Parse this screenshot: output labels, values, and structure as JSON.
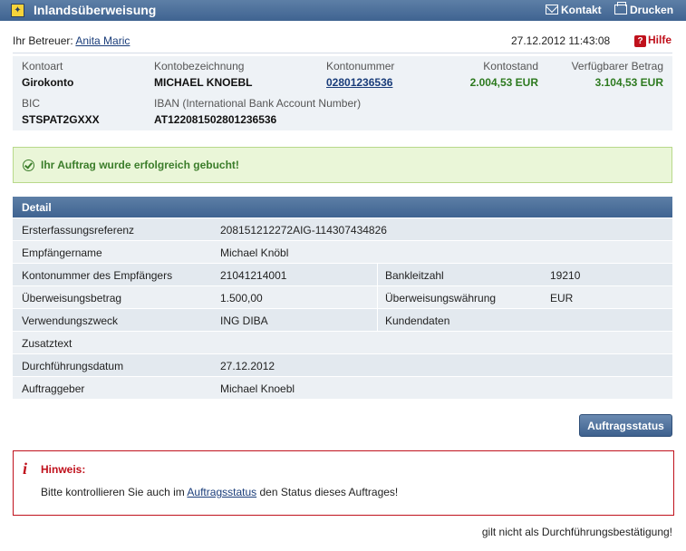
{
  "header": {
    "title": "Inlandsüberweisung",
    "kontakt_label": "Kontakt",
    "drucken_label": "Drucken"
  },
  "info": {
    "betreuer_label": "Ihr Betreuer:",
    "betreuer_name": "Anita Maric",
    "datetime": "27.12.2012 11:43:08",
    "hilfe_label": "Hilfe"
  },
  "account": {
    "kontoart_label": "Kontoart",
    "kontoart": "Girokonto",
    "bezeichnung_label": "Kontobezeichnung",
    "bezeichnung": "MICHAEL KNOEBL",
    "nummer_label": "Kontonummer",
    "nummer": "02801236536",
    "stand_label": "Kontostand",
    "stand": "2.004,53 EUR",
    "verfuegbar_label": "Verfügbarer Betrag",
    "verfuegbar": "3.104,53 EUR",
    "bic_label": "BIC",
    "bic": "STSPAT2GXXX",
    "iban_label": "IBAN (International Bank Account Number)",
    "iban": "AT122081502801236536"
  },
  "success_message": "Ihr Auftrag wurde erfolgreich gebucht!",
  "detail": {
    "title": "Detail",
    "rows": [
      {
        "label": "Ersterfassungsreferenz",
        "value": "208151212272AIG-114307434826"
      },
      {
        "label": "Empfängername",
        "value": "Michael Knöbl"
      },
      {
        "label": "Kontonummer des Empfängers",
        "value": "21041214001",
        "label2": "Bankleitzahl",
        "value2": "19210"
      },
      {
        "label": "Überweisungsbetrag",
        "value": "1.500,00",
        "label2": "Überweisungswährung",
        "value2": "EUR"
      },
      {
        "label": "Verwendungszweck",
        "value": "ING DIBA",
        "label2": "Kundendaten",
        "value2": ""
      },
      {
        "label": "Zusatztext",
        "value": ""
      },
      {
        "label": "Durchführungsdatum",
        "value": "27.12.2012"
      },
      {
        "label": "Auftraggeber",
        "value": "Michael Knoebl"
      }
    ]
  },
  "auftragsstatus_button": "Auftragsstatus",
  "hinweis": {
    "title": "Hinweis:",
    "text_before": "Bitte kontrollieren Sie auch im",
    "link": "Auftragsstatus",
    "text_after": "den Status dieses Auftrages!"
  },
  "footer_note": "gilt nicht als Durchführungsbestätigung!"
}
